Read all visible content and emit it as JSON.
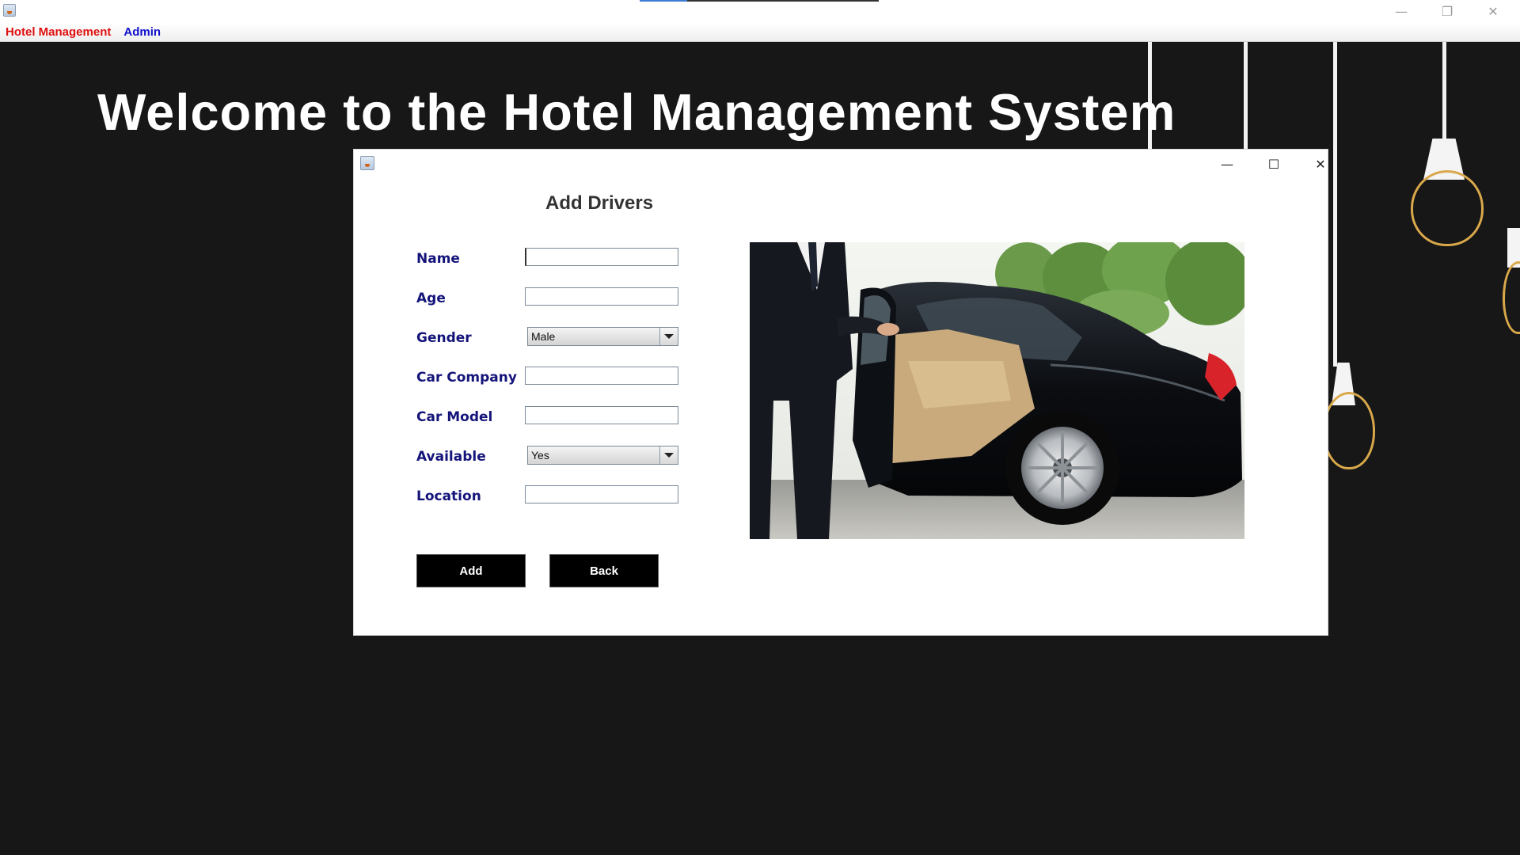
{
  "window": {
    "minimize_glyph": "—",
    "restore_glyph": "❐",
    "close_glyph": "✕"
  },
  "menubar": {
    "items": [
      {
        "label": "Hotel Management",
        "color": "#e01010"
      },
      {
        "label": "Admin",
        "color": "#1010cc"
      }
    ]
  },
  "background": {
    "welcome_text": "Welcome to the Hotel Management System"
  },
  "dialog": {
    "minimize_glyph": "—",
    "maximize_glyph": "☐",
    "close_glyph": "✕",
    "heading": "Add Drivers",
    "fields": {
      "name": {
        "label": "Name",
        "value": ""
      },
      "age": {
        "label": "Age",
        "value": ""
      },
      "gender": {
        "label": "Gender",
        "selected": "Male"
      },
      "car_company": {
        "label": "Car Company",
        "value": ""
      },
      "car_model": {
        "label": "Car Model",
        "value": ""
      },
      "available": {
        "label": "Available",
        "selected": "Yes"
      },
      "location": {
        "label": "Location",
        "value": ""
      }
    },
    "buttons": {
      "add": "Add",
      "back": "Back"
    },
    "image": {
      "subject": "chauffeur-opening-car-door"
    }
  },
  "colors": {
    "background": "#171717",
    "label_text": "#14147a",
    "button_bg": "#000000",
    "lamp_bulb": "#d9a84a"
  }
}
